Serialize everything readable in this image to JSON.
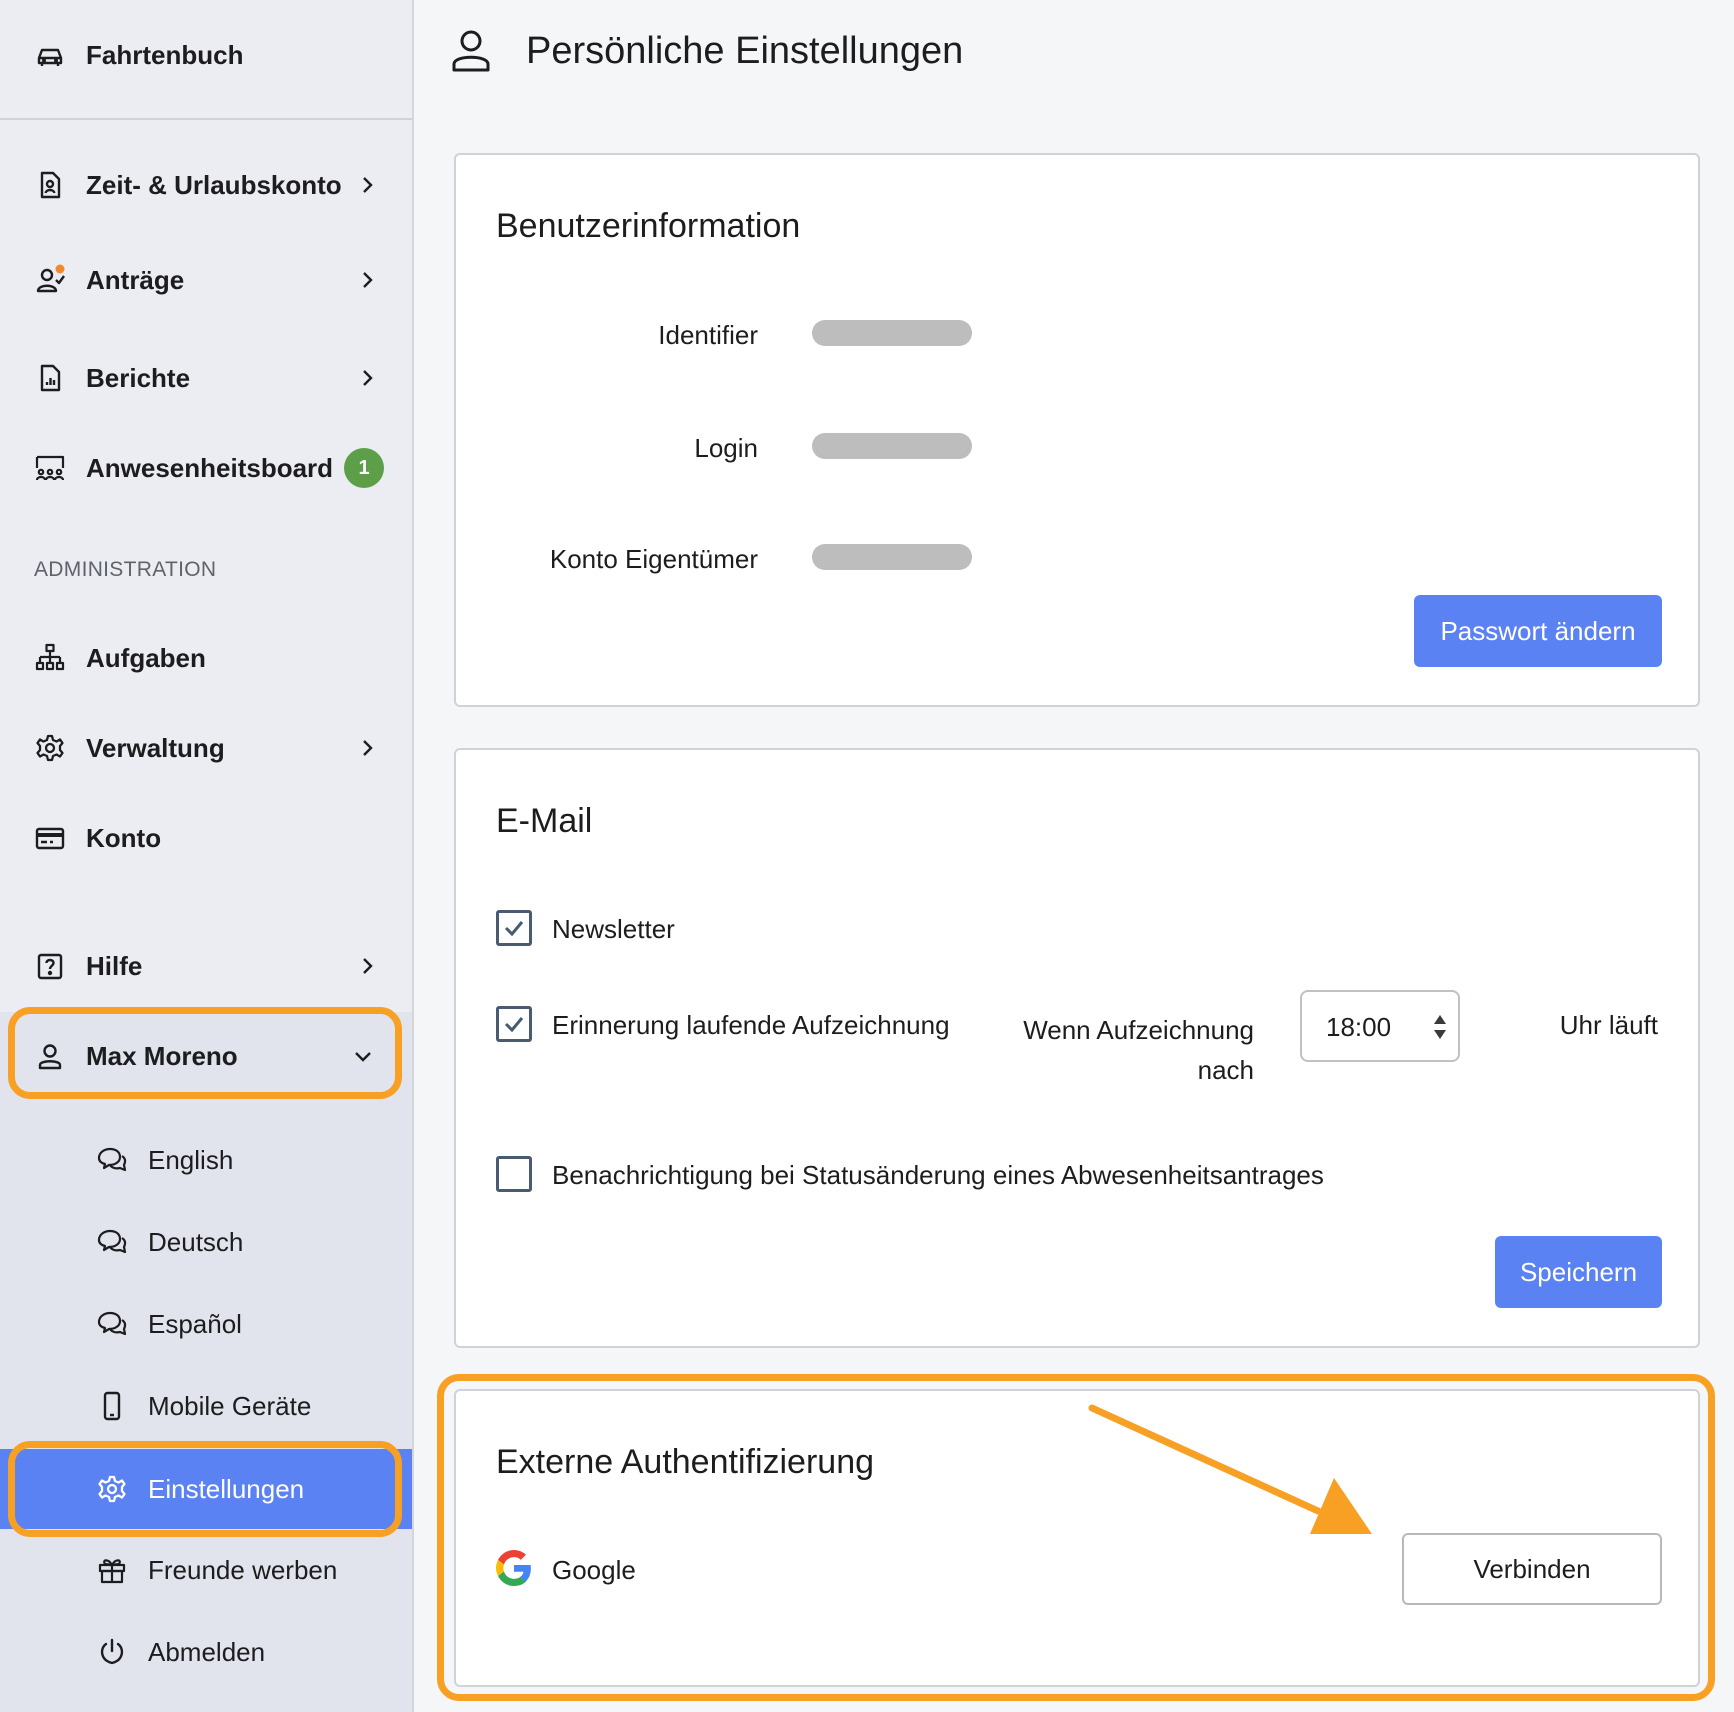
{
  "sidebar": {
    "top_item": "Fahrtenbuch",
    "items": [
      {
        "label": "Zeit- & Urlaubskonto",
        "icon": "document-user-icon"
      },
      {
        "label": "Anträge",
        "icon": "user-check-icon"
      },
      {
        "label": "Berichte",
        "icon": "report-icon"
      },
      {
        "label": "Anwesenheitsboard",
        "icon": "people-board-icon",
        "badge": "1"
      }
    ],
    "admin_section_label": "ADMINISTRATION",
    "admin_items": [
      {
        "label": "Aufgaben",
        "icon": "hierarchy-icon"
      },
      {
        "label": "Verwaltung",
        "icon": "gear-icon"
      },
      {
        "label": "Konto",
        "icon": "credit-card-icon"
      }
    ],
    "help_label": "Hilfe",
    "user_name": "Max Moreno",
    "user_menu": [
      {
        "label": "English",
        "icon": "chat-icon"
      },
      {
        "label": "Deutsch",
        "icon": "chat-icon"
      },
      {
        "label": "Español",
        "icon": "chat-icon"
      },
      {
        "label": "Mobile Geräte",
        "icon": "mobile-icon"
      },
      {
        "label": "Einstellungen",
        "icon": "gear-icon",
        "active": true
      },
      {
        "label": "Freunde werben",
        "icon": "gift-icon"
      },
      {
        "label": "Abmelden",
        "icon": "power-icon"
      }
    ]
  },
  "page": {
    "title": "Persönliche Einstellungen"
  },
  "user_info": {
    "title": "Benutzerinformation",
    "fields": [
      "Identifier",
      "Login",
      "Konto Eigentümer"
    ],
    "change_password_label": "Passwort ändern"
  },
  "email": {
    "title": "E-Mail",
    "newsletter_label": "Newsletter",
    "newsletter_checked": true,
    "reminder_label": "Erinnerung laufende Aufzeichnung",
    "reminder_checked": true,
    "when_label_line1": "Wenn Aufzeichnung",
    "when_label_line2": "nach",
    "time_value": "18:00",
    "suffix_label": "Uhr läuft",
    "status_change_label": "Benachrichtigung bei Statusänderung eines Abwesenheitsantrages",
    "status_change_checked": false,
    "save_label": "Speichern"
  },
  "external_auth": {
    "title": "Externe Authentifizierung",
    "provider": "Google",
    "connect_label": "Verbinden"
  },
  "colors": {
    "accent": "#5b82f3",
    "highlight": "#f7a024",
    "badge": "#5c9f48",
    "notification_dot": "#f08a2c"
  }
}
